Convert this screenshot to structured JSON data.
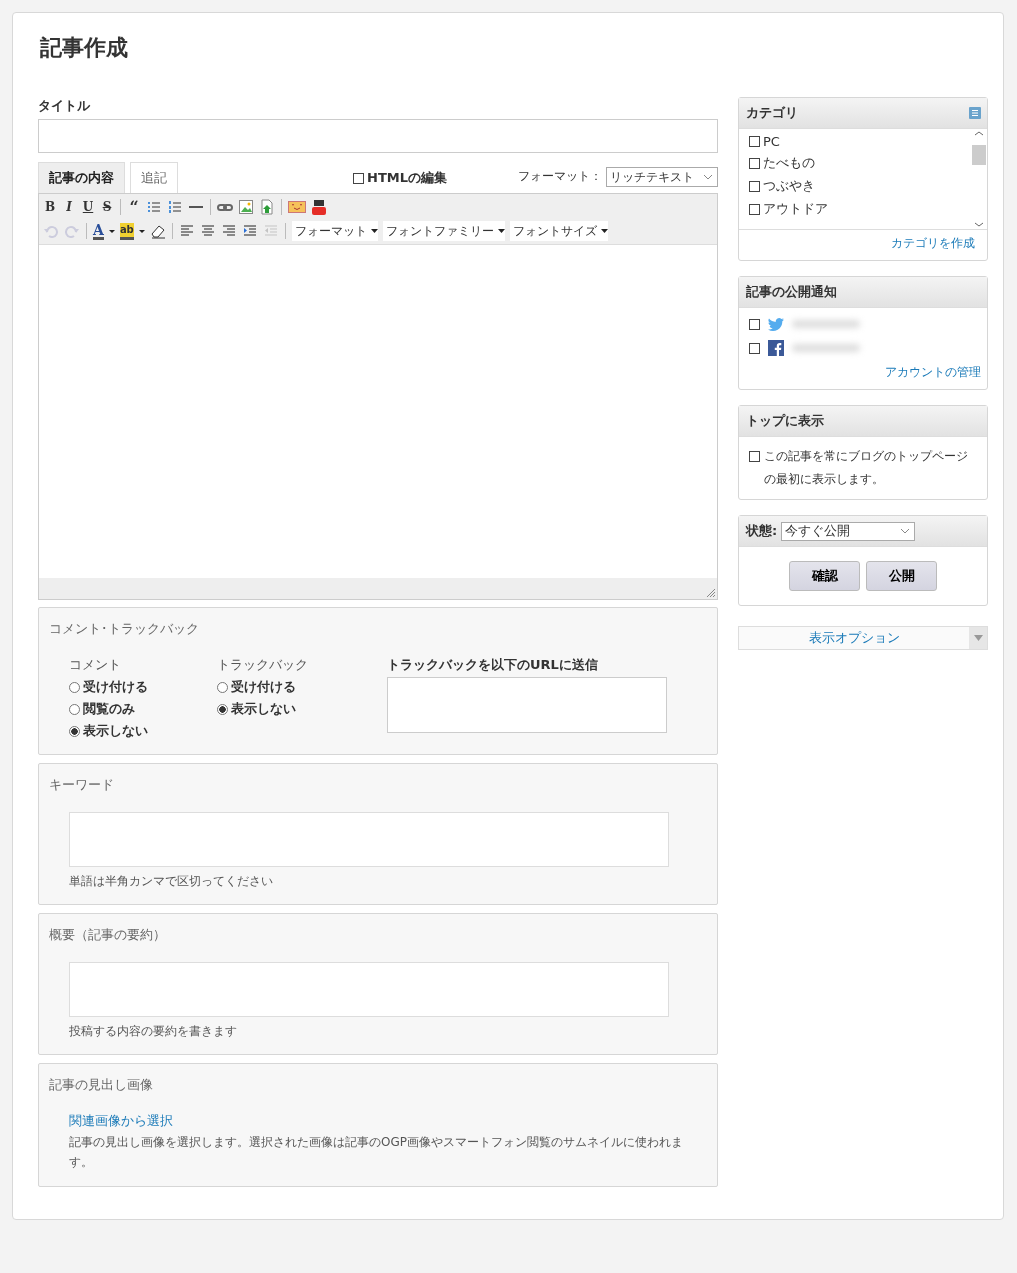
{
  "page_title": "記事作成",
  "title_field": {
    "label": "タイトル"
  },
  "editor": {
    "tabs": [
      {
        "label": "記事の内容",
        "selected": true
      },
      {
        "label": "追記",
        "selected": false
      }
    ],
    "html_edit": {
      "label": "HTMLの編集",
      "checked": false
    },
    "format": {
      "label": "フォーマット：",
      "value": "リッチテキスト"
    },
    "toolbar_rows": [
      [
        {
          "kind": "bold",
          "label": "B"
        },
        {
          "kind": "italic",
          "label": "I"
        },
        {
          "kind": "underline",
          "label": "U"
        },
        {
          "kind": "strike",
          "label": "S"
        },
        {
          "kind": "sep"
        },
        {
          "kind": "quote",
          "label": "“"
        },
        {
          "kind": "bullets"
        },
        {
          "kind": "numbers"
        },
        {
          "kind": "rule"
        },
        {
          "kind": "sep"
        },
        {
          "kind": "link"
        },
        {
          "kind": "image"
        },
        {
          "kind": "upload"
        },
        {
          "kind": "sep"
        },
        {
          "kind": "emoji"
        },
        {
          "kind": "youtube"
        }
      ],
      [
        {
          "kind": "undo",
          "disabled": true
        },
        {
          "kind": "redo",
          "disabled": true
        },
        {
          "kind": "sep"
        },
        {
          "kind": "textcolor",
          "label": "A"
        },
        {
          "kind": "highlight",
          "label": "ab"
        },
        {
          "kind": "eraser"
        },
        {
          "kind": "sep"
        },
        {
          "kind": "alignleft"
        },
        {
          "kind": "aligncenter"
        },
        {
          "kind": "alignright"
        },
        {
          "kind": "indent",
          "disabled": false
        },
        {
          "kind": "outdent",
          "disabled": true
        },
        {
          "kind": "sep"
        },
        {
          "kind": "select",
          "label": "フォーマット"
        },
        {
          "kind": "select",
          "label": "フォントファミリー"
        },
        {
          "kind": "select",
          "label": "フォントサイズ"
        }
      ]
    ]
  },
  "comments_section": {
    "title": "コメント･トラックバック",
    "groups": [
      {
        "label": "コメント",
        "options": [
          {
            "label": "受け付ける",
            "selected": false
          },
          {
            "label": "閲覧のみ",
            "selected": false
          },
          {
            "label": "表示しない",
            "selected": true
          }
        ]
      },
      {
        "label": "トラックバック",
        "options": [
          {
            "label": "受け付ける",
            "selected": false
          },
          {
            "label": "表示しない",
            "selected": true
          }
        ]
      }
    ],
    "trackback_url": {
      "label": "トラックバックを以下のURLに送信"
    }
  },
  "keyword_section": {
    "title": "キーワード",
    "hint": "単語は半角カンマで区切ってください"
  },
  "summary_section": {
    "title": "概要（記事の要約）",
    "hint": "投稿する内容の要約を書きます"
  },
  "image_section": {
    "title": "記事の見出し画像",
    "link": "関連画像から選択",
    "description": "記事の見出し画像を選択します。選択された画像は記事のOGP画像やスマートフォン閲覧のサムネイルに使われます。"
  },
  "sidebar": {
    "category": {
      "title": "カテゴリ",
      "items": [
        {
          "label": "PC",
          "checked": false
        },
        {
          "label": "たべもの",
          "checked": false
        },
        {
          "label": "つぶやき",
          "checked": false
        },
        {
          "label": "アウトドア",
          "checked": false
        }
      ],
      "create_link": "カテゴリを作成"
    },
    "notify": {
      "title": "記事の公開通知",
      "accounts": [
        {
          "kind": "twitter",
          "checked": false
        },
        {
          "kind": "facebook",
          "checked": false
        }
      ],
      "manage_link": "アカウントの管理"
    },
    "top": {
      "title": "トップに表示",
      "label": "この記事を常にブログのトップページの最初に表示します。",
      "checked": false
    },
    "status": {
      "label": "状態:",
      "value": "今すぐ公開",
      "buttons": [
        "確認",
        "公開"
      ]
    },
    "options": {
      "label": "表示オプション"
    }
  }
}
